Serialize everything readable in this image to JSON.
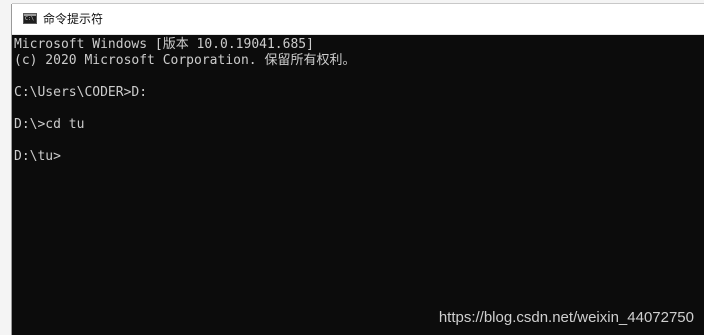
{
  "window": {
    "title": "命令提示符",
    "icon": "cmd-console-icon"
  },
  "console": {
    "lines": [
      "Microsoft Windows [版本 10.0.19041.685]",
      "(c) 2020 Microsoft Corporation. 保留所有权利。",
      "",
      "C:\\Users\\CODER>D:",
      "",
      "D:\\>cd tu",
      "",
      "D:\\tu>"
    ],
    "text_color": "#cccccc",
    "background_color": "#0c0c0c"
  },
  "watermark": {
    "text": "https://blog.csdn.net/weixin_44072750"
  }
}
